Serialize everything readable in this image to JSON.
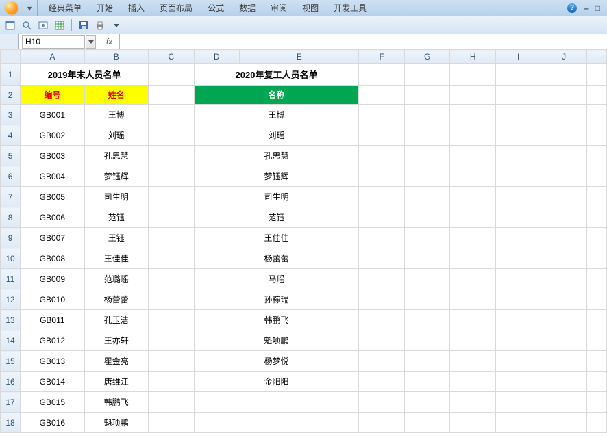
{
  "ribbon": {
    "tabs": [
      "经典菜单",
      "开始",
      "插入",
      "页面布局",
      "公式",
      "数据",
      "审阅",
      "视图",
      "开发工具"
    ],
    "qat_dropdown": "▾",
    "help_tip": "?",
    "minimize": "–",
    "restore": "□"
  },
  "toolbar": {
    "items": [
      {
        "name": "new-sheet-icon",
        "glyph": "sheet"
      },
      {
        "name": "search-icon",
        "glyph": "mag"
      },
      {
        "name": "preview-icon",
        "glyph": "eye"
      },
      {
        "name": "table-icon",
        "glyph": "grid"
      },
      {
        "name": "sep",
        "glyph": "sep"
      },
      {
        "name": "save-icon",
        "glyph": "floppy"
      },
      {
        "name": "print-icon",
        "glyph": "printer"
      },
      {
        "name": "dropdown-icon",
        "glyph": "dd"
      }
    ]
  },
  "namebox": {
    "value": "H10"
  },
  "fx": {
    "label": "fx",
    "value": ""
  },
  "columns": [
    "A",
    "B",
    "C",
    "D",
    "E",
    "F",
    "G",
    "H",
    "I",
    "J"
  ],
  "row_numbers": [
    1,
    2,
    3,
    4,
    5,
    6,
    7,
    8,
    9,
    10,
    11,
    12,
    13,
    14,
    15,
    16,
    17,
    18
  ],
  "titles": {
    "left": "2019年末人员名单",
    "right": "2020年复工人员名单"
  },
  "headers": {
    "id": "编号",
    "name": "姓名",
    "rname": "名称"
  },
  "rows": [
    {
      "id": "GB001",
      "name": "王博",
      "rname": "王博"
    },
    {
      "id": "GB002",
      "name": "刘瑶",
      "rname": "刘瑶"
    },
    {
      "id": "GB003",
      "name": "孔思慧",
      "rname": "孔思慧"
    },
    {
      "id": "GB004",
      "name": "梦钰辉",
      "rname": "梦钰辉"
    },
    {
      "id": "GB005",
      "name": "司生明",
      "rname": "司生明"
    },
    {
      "id": "GB006",
      "name": "范钰",
      "rname": "范钰"
    },
    {
      "id": "GB007",
      "name": "王钰",
      "rname": "王佳佳"
    },
    {
      "id": "GB008",
      "name": "王佳佳",
      "rname": "杨蕾蕾"
    },
    {
      "id": "GB009",
      "name": "范璐瑶",
      "rname": "马瑶"
    },
    {
      "id": "GB010",
      "name": "杨蕾蕾",
      "rname": "孙稼瑞"
    },
    {
      "id": "GB011",
      "name": "孔玉洁",
      "rname": "韩鹏飞"
    },
    {
      "id": "GB012",
      "name": "王亦轩",
      "rname": "魁项鹏"
    },
    {
      "id": "GB013",
      "name": "瞿金亮",
      "rname": "杨梦悦"
    },
    {
      "id": "GB014",
      "name": "唐维江",
      "rname": "金阳阳"
    },
    {
      "id": "GB015",
      "name": "韩鹏飞",
      "rname": ""
    },
    {
      "id": "GB016",
      "name": "魁项鹏",
      "rname": ""
    }
  ]
}
